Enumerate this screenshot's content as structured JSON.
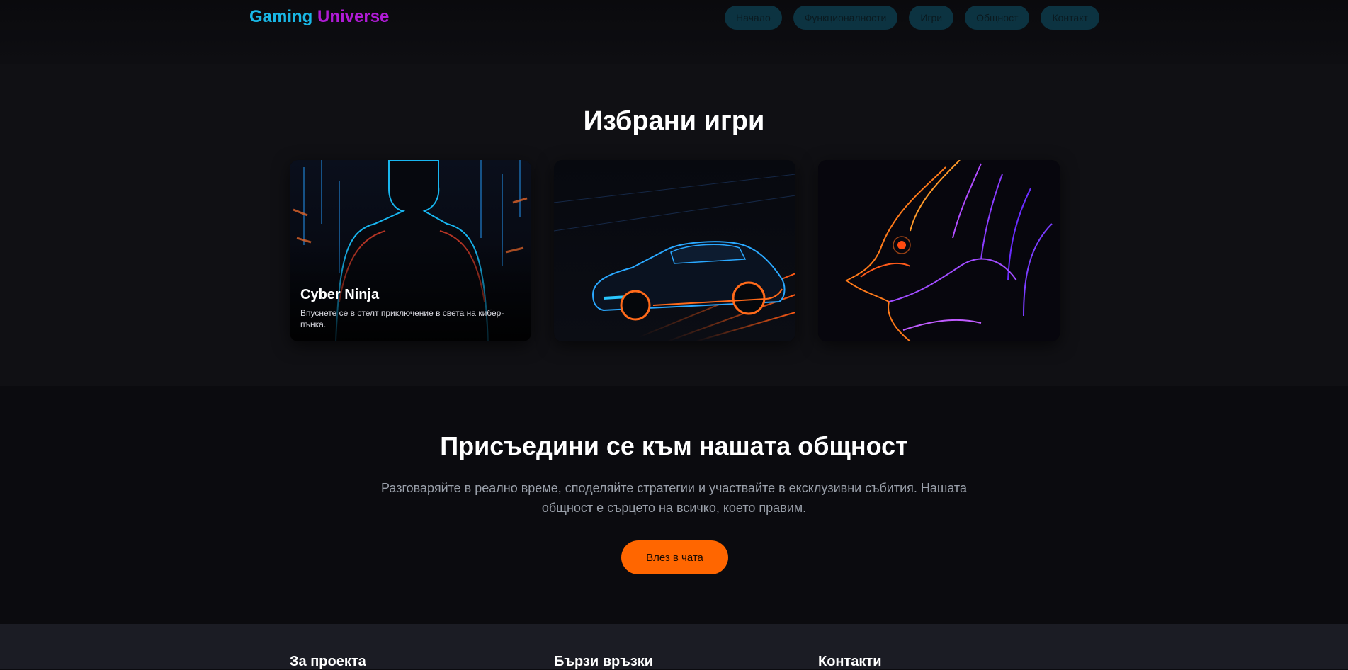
{
  "header": {
    "logo_part1": "Gaming",
    "logo_part2": "Universe",
    "nav": [
      "Начало",
      "Функционалности",
      "Игри",
      "Общност",
      "Контакт"
    ]
  },
  "games": {
    "title": "Избрани игри",
    "cards": [
      {
        "image": "cyber-ninja-silhouette",
        "title": "Cyber Ninja",
        "description": "Впуснете се в стелт приключение в света на кибер-пънка."
      },
      {
        "image": "neon-sports-car"
      },
      {
        "image": "neon-dragon-head"
      }
    ]
  },
  "community": {
    "title": "Присъедини се към нашата общност",
    "text": "Разговаряйте в реално време, споделяйте стратегии и участвайте в ексклузивни събития. Нашата общност е сърцето на всичко, което правим.",
    "button": "Влез в чата"
  },
  "footer": {
    "columns": [
      "За проекта",
      "Бързи връзки",
      "Контакти"
    ]
  },
  "colors": {
    "accent_cyan": "#19b8e6",
    "accent_purple": "#b01bd6",
    "accent_orange": "#ff6600",
    "nav_bg": "#0c3341"
  }
}
